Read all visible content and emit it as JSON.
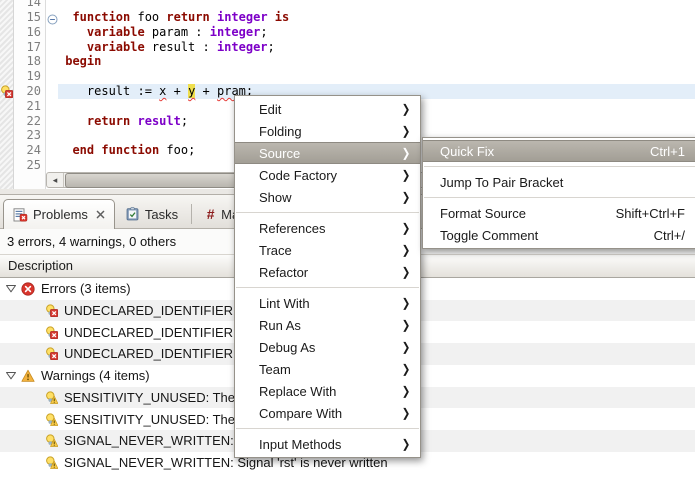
{
  "colors": {
    "keyword": "#8B0A00",
    "type": "#7D00C8",
    "current_line_highlight": "#E3EEF9",
    "occurrence_highlight": "#EFDF4E",
    "error_squiggle": "#E53935",
    "menu_selected_gradient_top": "#BCB8B0",
    "menu_selected_gradient_bottom": "#A19D94",
    "alt_row": "#F1F1F1"
  },
  "editor": {
    "current_line_num": "20",
    "ruler_marker": {
      "line": "20",
      "icon": "error-quickfix-icon"
    },
    "scrollbar": {
      "left_arrow": "◂",
      "right_arrow": "▸"
    },
    "lines": [
      {
        "num": "14",
        "tokens": []
      },
      {
        "num": "15",
        "fold": true,
        "tokens": [
          {
            "text": "  ",
            "style": "p"
          },
          {
            "text": "function",
            "style": "k"
          },
          {
            "text": " foo ",
            "style": "p"
          },
          {
            "text": "return",
            "style": "k"
          },
          {
            "text": " ",
            "style": "p"
          },
          {
            "text": "integer",
            "style": "t"
          },
          {
            "text": " ",
            "style": "p"
          },
          {
            "text": "is",
            "style": "k"
          }
        ]
      },
      {
        "num": "16",
        "tokens": [
          {
            "text": "    ",
            "style": "p"
          },
          {
            "text": "variable",
            "style": "k"
          },
          {
            "text": " param : ",
            "style": "p"
          },
          {
            "text": "integer",
            "style": "t"
          },
          {
            "text": ";",
            "style": "p"
          }
        ]
      },
      {
        "num": "17",
        "tokens": [
          {
            "text": "    ",
            "style": "p"
          },
          {
            "text": "variable",
            "style": "k"
          },
          {
            "text": " result : ",
            "style": "p"
          },
          {
            "text": "integer",
            "style": "t"
          },
          {
            "text": ";",
            "style": "p"
          }
        ]
      },
      {
        "num": "18",
        "tokens": [
          {
            "text": " ",
            "style": "p"
          },
          {
            "text": "begin",
            "style": "k"
          }
        ]
      },
      {
        "num": "19",
        "tokens": []
      },
      {
        "num": "20",
        "current": true,
        "tokens": [
          {
            "text": "    result := ",
            "style": "p"
          },
          {
            "text": "x",
            "style": "e"
          },
          {
            "text": " + ",
            "style": "p"
          },
          {
            "text": "y",
            "style": "eh"
          },
          {
            "text": " + ",
            "style": "p"
          },
          {
            "text": "pram",
            "style": "e"
          },
          {
            "text": ";",
            "style": "p"
          }
        ]
      },
      {
        "num": "21",
        "tokens": []
      },
      {
        "num": "22",
        "tokens": [
          {
            "text": "    ",
            "style": "p"
          },
          {
            "text": "return",
            "style": "k"
          },
          {
            "text": " ",
            "style": "p"
          },
          {
            "text": "result",
            "style": "t"
          },
          {
            "text": ";",
            "style": "p"
          }
        ]
      },
      {
        "num": "23",
        "tokens": []
      },
      {
        "num": "24",
        "tokens": [
          {
            "text": "  ",
            "style": "p"
          },
          {
            "text": "end",
            "style": "k"
          },
          {
            "text": " ",
            "style": "p"
          },
          {
            "text": "function",
            "style": "k"
          },
          {
            "text": " foo;",
            "style": "p"
          }
        ]
      },
      {
        "num": "25",
        "tokens": []
      }
    ]
  },
  "context_menu": {
    "items": [
      {
        "label": "Edit",
        "submenu": true
      },
      {
        "label": "Folding",
        "submenu": true
      },
      {
        "label": "Source",
        "submenu": true,
        "selected": true
      },
      {
        "label": "Code Factory",
        "submenu": true
      },
      {
        "label": "Show",
        "submenu": true
      },
      {
        "separator": true
      },
      {
        "label": "References",
        "submenu": true
      },
      {
        "label": "Trace",
        "submenu": true
      },
      {
        "label": "Refactor",
        "submenu": true
      },
      {
        "separator": true
      },
      {
        "label": "Lint With",
        "submenu": true
      },
      {
        "label": "Run As",
        "submenu": true
      },
      {
        "label": "Debug As",
        "submenu": true
      },
      {
        "label": "Team",
        "submenu": true
      },
      {
        "label": "Replace With",
        "submenu": true
      },
      {
        "label": "Compare With",
        "submenu": true
      },
      {
        "separator": true
      },
      {
        "label": "Input Methods",
        "submenu": true
      }
    ]
  },
  "source_submenu": {
    "items": [
      {
        "label": "Quick Fix",
        "shortcut": "Ctrl+1",
        "selected": true
      },
      {
        "separator": true
      },
      {
        "label": "Jump To Pair Bracket",
        "shortcut": ""
      },
      {
        "separator": true
      },
      {
        "label": "Format Source",
        "shortcut": "Shift+Ctrl+F"
      },
      {
        "label": "Toggle Comment",
        "shortcut": "Ctrl+/"
      }
    ]
  },
  "problems_view": {
    "tabs": [
      {
        "label": "Problems",
        "icon": "problems-icon",
        "active": true,
        "closable": true
      },
      {
        "label": "Tasks",
        "icon": "tasks-icon"
      },
      {
        "label": "Markers",
        "icon": "markers-icon"
      }
    ],
    "summary": "3 errors, 4 warnings, 0 others",
    "column_header": "Description",
    "rows": [
      {
        "kind": "group",
        "icon": "error-icon",
        "text": "Errors (3 items)"
      },
      {
        "kind": "item",
        "icon": "error-quickfix-icon",
        "text": "UNDECLARED_IDENTIFIER: Identifier 'pram' is not declared"
      },
      {
        "kind": "item",
        "icon": "error-quickfix-icon",
        "text": "UNDECLARED_IDENTIFIER: Identifier 'x' is not declared"
      },
      {
        "kind": "item",
        "icon": "error-quickfix-icon",
        "text": "UNDECLARED_IDENTIFIER: Identifier 'y' is not declared"
      },
      {
        "kind": "group",
        "icon": "warning-icon",
        "text": "Warnings (4 items)"
      },
      {
        "kind": "item",
        "icon": "warning-quickfix-icon",
        "text": "SENSITIVITY_UNUSED: The process is not sensitive to 'clk'"
      },
      {
        "kind": "item",
        "icon": "warning-quickfix-icon",
        "text": "SENSITIVITY_UNUSED: The process is not sensitive to 'rst'"
      },
      {
        "kind": "item",
        "icon": "warning-quickfix-icon",
        "text": "SIGNAL_NEVER_WRITTEN: Signal 'clk' is never written"
      },
      {
        "kind": "item",
        "icon": "warning-quickfix-icon",
        "text": "SIGNAL_NEVER_WRITTEN: Signal 'rst' is never written"
      }
    ]
  }
}
